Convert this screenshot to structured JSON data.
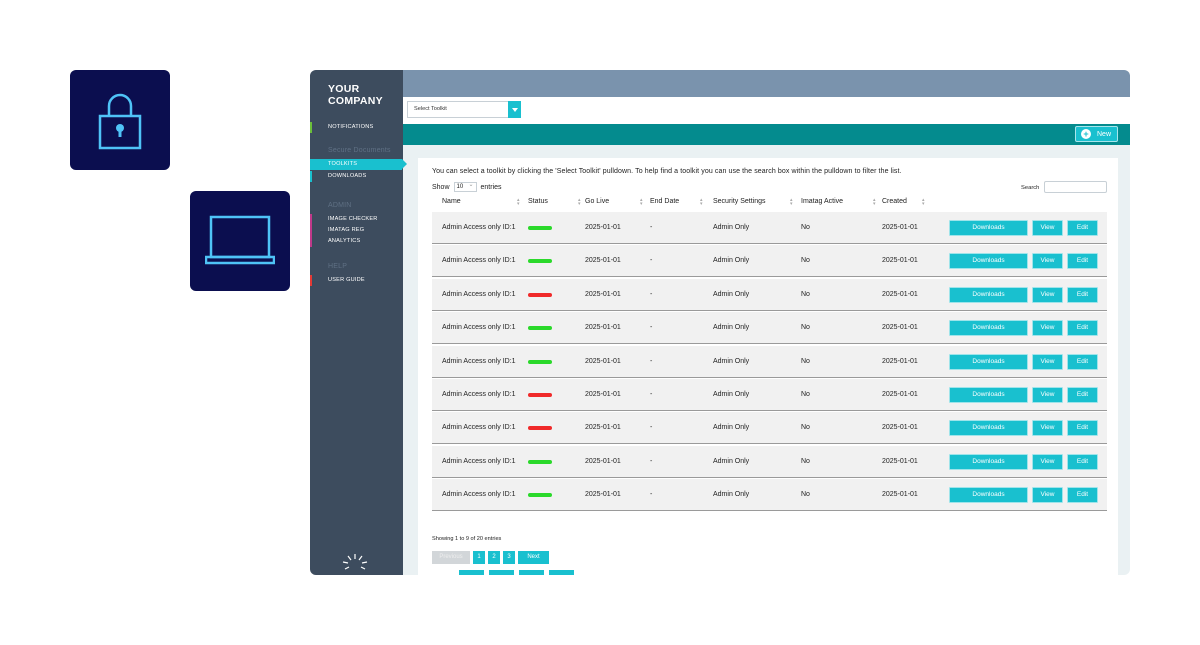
{
  "decor": {
    "lock_icon": "padlock-icon",
    "laptop_icon": "laptop-icon",
    "tile_color": "#0b0e4f",
    "icon_color": "#4fc3f7"
  },
  "sidebar": {
    "logo_line1": "YOUR",
    "logo_line2": "COMPANY",
    "notifications": "NOTIFICATIONS",
    "secure_heading": "Secure Documents",
    "toolkits": "TOOLKITS",
    "downloads": "DOWNLOADS",
    "admin_heading": "ADMIN",
    "image_checker": "IMAGE CHECKER",
    "imatag_reg": "IMATAG REG",
    "analytics": "ANALYTICS",
    "help_heading": "HELP",
    "user_guide": "USER GUIDE"
  },
  "toolbar": {
    "select_placeholder": "Select Toolkit",
    "new_label": "New"
  },
  "table": {
    "intro": "You can select a toolkit by clicking the 'Select Toolkit' pulldown. To help find a toolkit you can use the search box within the pulldown to filter the list.",
    "show_label": "Show",
    "show_value": "10",
    "entries_label": "entries",
    "search_label": "Search",
    "columns": [
      "Name",
      "Status",
      "Go Live",
      "End Date",
      "Security Settings",
      "Imatag Active",
      "Created"
    ],
    "rows": [
      {
        "name": "Admin Access only ID:1",
        "status": "green",
        "go_live": "2025-01-01",
        "end_date": "-",
        "security": "Admin Only",
        "imatag": "No",
        "created": "2025-01-01"
      },
      {
        "name": "Admin Access only ID:1",
        "status": "green",
        "go_live": "2025-01-01",
        "end_date": "-",
        "security": "Admin Only",
        "imatag": "No",
        "created": "2025-01-01"
      },
      {
        "name": "Admin Access only ID:1",
        "status": "red",
        "go_live": "2025-01-01",
        "end_date": "-",
        "security": "Admin Only",
        "imatag": "No",
        "created": "2025-01-01"
      },
      {
        "name": "Admin Access only ID:1",
        "status": "green",
        "go_live": "2025-01-01",
        "end_date": "-",
        "security": "Admin Only",
        "imatag": "No",
        "created": "2025-01-01"
      },
      {
        "name": "Admin Access only ID:1",
        "status": "green",
        "go_live": "2025-01-01",
        "end_date": "-",
        "security": "Admin Only",
        "imatag": "No",
        "created": "2025-01-01"
      },
      {
        "name": "Admin Access only ID:1",
        "status": "red",
        "go_live": "2025-01-01",
        "end_date": "-",
        "security": "Admin Only",
        "imatag": "No",
        "created": "2025-01-01"
      },
      {
        "name": "Admin Access only ID:1",
        "status": "red",
        "go_live": "2025-01-01",
        "end_date": "-",
        "security": "Admin Only",
        "imatag": "No",
        "created": "2025-01-01"
      },
      {
        "name": "Admin Access only ID:1",
        "status": "green",
        "go_live": "2025-01-01",
        "end_date": "-",
        "security": "Admin Only",
        "imatag": "No",
        "created": "2025-01-01"
      },
      {
        "name": "Admin Access only ID:1",
        "status": "green",
        "go_live": "2025-01-01",
        "end_date": "-",
        "security": "Admin Only",
        "imatag": "No",
        "created": "2025-01-01"
      }
    ],
    "downloads_btn": "Downloads",
    "view_btn": "View",
    "edit_btn": "Edit",
    "status_colors": {
      "green": "#2bd92b",
      "red": "#f02a2a"
    }
  },
  "footer": {
    "showing": "Showing 1 to 9 of 20 entries",
    "previous": "Previous",
    "pages": [
      "1",
      "2",
      "3"
    ],
    "next": "Next"
  }
}
